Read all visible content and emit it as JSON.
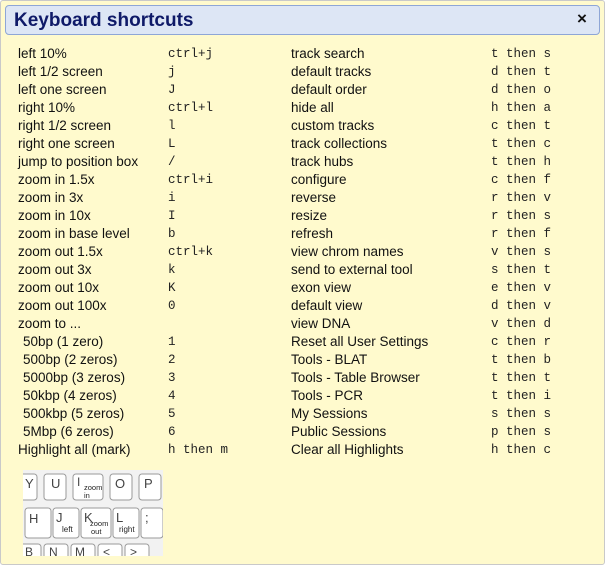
{
  "dialog": {
    "title": "Keyboard shortcuts",
    "close_label": "×"
  },
  "left_shortcuts": [
    {
      "label": "left 10%",
      "key": "ctrl+j"
    },
    {
      "label": "left 1/2 screen",
      "key": "j"
    },
    {
      "label": "left one screen",
      "key": "J"
    },
    {
      "label": "right 10%",
      "key": "ctrl+l"
    },
    {
      "label": "right 1/2 screen",
      "key": "l"
    },
    {
      "label": "right one screen",
      "key": "L"
    },
    {
      "label": "jump to position box",
      "key": "/"
    },
    {
      "label": "zoom in 1.5x",
      "key": "ctrl+i"
    },
    {
      "label": "zoom in 3x",
      "key": "i"
    },
    {
      "label": "zoom in 10x",
      "key": "I"
    },
    {
      "label": "zoom in base level",
      "key": "b"
    },
    {
      "label": "zoom out 1.5x",
      "key": "ctrl+k"
    },
    {
      "label": "zoom out 3x",
      "key": "k"
    },
    {
      "label": "zoom out 10x",
      "key": "K"
    },
    {
      "label": "zoom out 100x",
      "key": "0"
    },
    {
      "label": "zoom to ...",
      "key": ""
    },
    {
      "label": "50bp (1 zero)",
      "key": "1"
    },
    {
      "label": "500bp (2 zeros)",
      "key": "2"
    },
    {
      "label": "5000bp (3 zeros)",
      "key": "3"
    },
    {
      "label": "50kbp (4 zeros)",
      "key": "4"
    },
    {
      "label": "500kbp (5 zeros)",
      "key": "5"
    },
    {
      "label": "5Mbp (6 zeros)",
      "key": "6"
    },
    {
      "label": "Highlight all (mark)",
      "key": "h then m"
    }
  ],
  "right_shortcuts": [
    {
      "label": "track search",
      "key": "t then s"
    },
    {
      "label": "default tracks",
      "key": "d then t"
    },
    {
      "label": "default order",
      "key": "d then o"
    },
    {
      "label": "hide all",
      "key": "h then a"
    },
    {
      "label": "custom tracks",
      "key": "c then t"
    },
    {
      "label": "track collections",
      "key": "t then c"
    },
    {
      "label": "track hubs",
      "key": "t then h"
    },
    {
      "label": "configure",
      "key": "c then f"
    },
    {
      "label": "reverse",
      "key": "r then v"
    },
    {
      "label": "resize",
      "key": "r then s"
    },
    {
      "label": "refresh",
      "key": "r then f"
    },
    {
      "label": "view chrom names",
      "key": "v then s"
    },
    {
      "label": "send to external tool",
      "key": "s then t"
    },
    {
      "label": "exon view",
      "key": "e then v"
    },
    {
      "label": "default view",
      "key": "d then v"
    },
    {
      "label": "view DNA",
      "key": "v then d"
    },
    {
      "label": "Reset all User Settings",
      "key": "c then r"
    },
    {
      "label": "Tools - BLAT",
      "key": "t then b"
    },
    {
      "label": "Tools - Table Browser",
      "key": "t then t"
    },
    {
      "label": "Tools - PCR",
      "key": "t then i"
    },
    {
      "label": "My Sessions",
      "key": "s then s"
    },
    {
      "label": "Public Sessions",
      "key": "p then s"
    },
    {
      "label": "Clear all Highlights",
      "key": "h then c"
    }
  ],
  "keyboard_image": {
    "row1_keys": [
      "Y",
      "U",
      "I",
      "O",
      "P"
    ],
    "row2_keys": [
      "H",
      "J",
      "K",
      "L",
      ";"
    ],
    "row3_keys": [
      "B",
      "N",
      "M",
      "<",
      ">"
    ],
    "i_key_caption": "zoom in",
    "j_key_caption": "left",
    "k_key_caption": "zoom out",
    "l_key_caption": "right"
  }
}
